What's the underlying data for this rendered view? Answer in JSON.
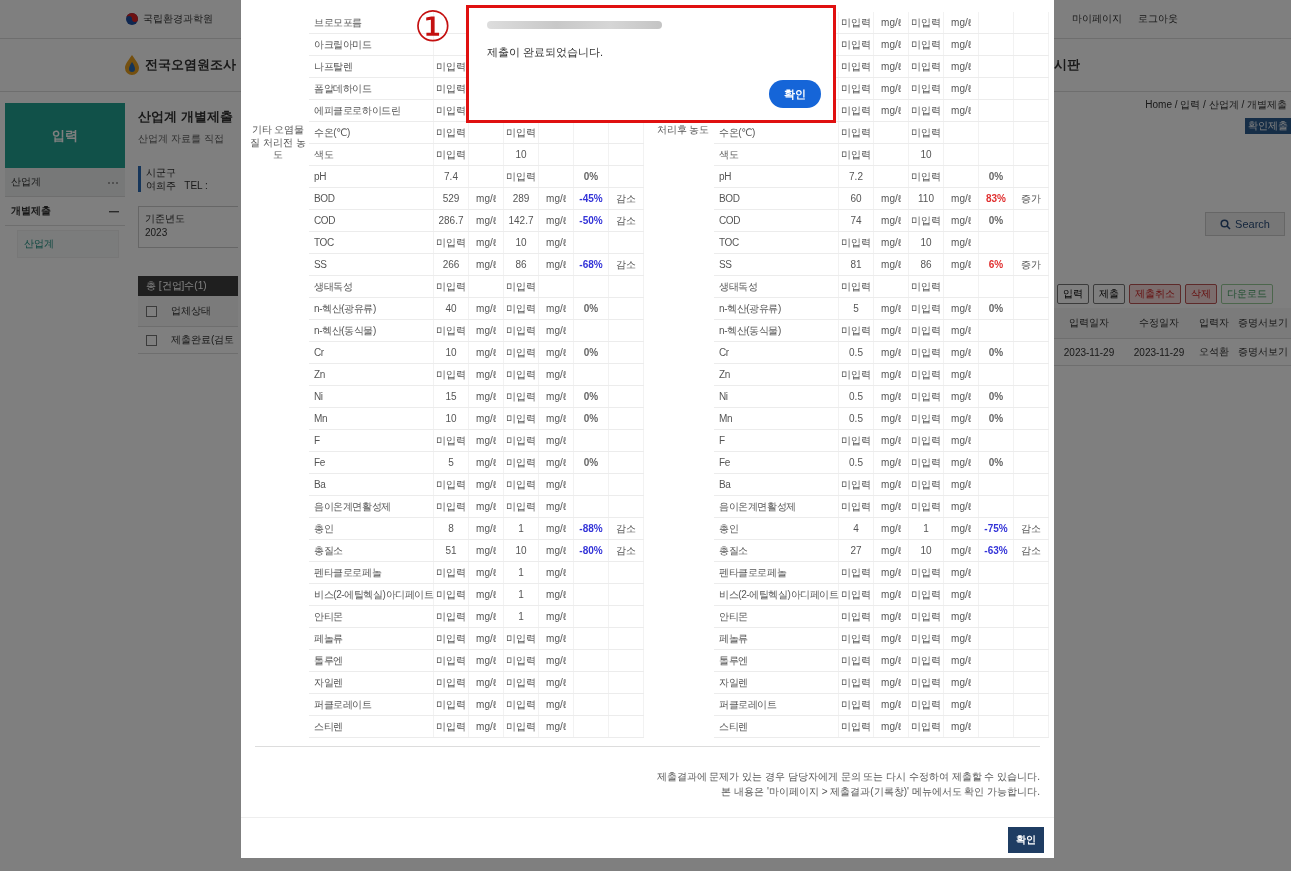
{
  "site": {
    "agency": "국립환경과학원",
    "title": "전국오염원조사",
    "user_links": [
      "마이페이지",
      "로그아웃"
    ],
    "board_fragment": "시판"
  },
  "sidebar": {
    "banner": "입력",
    "items": [
      {
        "label": "산업계",
        "expanded": false
      },
      {
        "label": "개별제출",
        "expanded": true,
        "children": [
          {
            "label": "산업계",
            "selected": true
          }
        ]
      }
    ]
  },
  "page": {
    "title": "산업계 개별제출",
    "subtitle": "산업계 자료를 직접",
    "breadcrumb": "Home / 입력 / 산업계 / 개별제출",
    "badge": "확인제출"
  },
  "info": {
    "label": "시군구",
    "value": "여희주",
    "tel_label": "TEL :"
  },
  "filter": {
    "label": "기준년도",
    "value": "2023",
    "search_button": "Search"
  },
  "list": {
    "summary": "총 [건업]수(1)",
    "header_checked": false,
    "actions": [
      {
        "label": "입력",
        "kind": "default"
      },
      {
        "label": "제출",
        "kind": "default"
      },
      {
        "label": "제출취소",
        "kind": "danger"
      },
      {
        "label": "삭제",
        "kind": "danger"
      },
      {
        "label": "다운로드",
        "kind": "download"
      }
    ],
    "columns_left": [
      "업체상태"
    ],
    "columns_right": [
      "입력일자",
      "수정일자",
      "입력자",
      "증명서보기"
    ],
    "rows": [
      {
        "checked": false,
        "left": [
          "제출완료(검토"
        ],
        "right": [
          "2023-11-29",
          "2023-11-29",
          "오석환",
          "증명서보기"
        ]
      }
    ]
  },
  "modal": {
    "groups": [
      {
        "label": "기타 오염물질 처리전 농도",
        "rows": [
          {
            "name": "브로모포름"
          },
          {
            "name": "아크릴아미드"
          },
          {
            "name": "나프탈렌",
            "column_2": "미입력"
          },
          {
            "name": "폼알데하이드",
            "column_2": "미입력"
          },
          {
            "name": "에피클로로하이드린",
            "column_2": "미입력"
          },
          {
            "name": "수온(℃)",
            "column_2": "미입력",
            "column_4": "미입력"
          },
          {
            "name": "색도",
            "column_2": "미입력",
            "column_4": "10"
          },
          {
            "name": "pH",
            "column_2": "7.4",
            "column_4": "미입력",
            "column_6": "0%",
            "color": "#666666"
          },
          {
            "name": "BOD",
            "column_2": "529",
            "column_3": "mg/ℓ",
            "column_4": "289",
            "column_5": "mg/ℓ",
            "column_6": "-45%",
            "column_7": "감소",
            "color": "#3434d8"
          },
          {
            "name": "COD",
            "column_2": "286.7",
            "column_3": "mg/ℓ",
            "column_4": "142.7",
            "column_5": "mg/ℓ",
            "column_6": "-50%",
            "column_7": "감소",
            "color": "#3434d8"
          },
          {
            "name": "TOC",
            "column_2": "미입력",
            "column_3": "mg/ℓ",
            "column_4": "10",
            "column_5": "mg/ℓ"
          },
          {
            "name": "SS",
            "column_2": "266",
            "column_3": "mg/ℓ",
            "column_4": "86",
            "column_5": "mg/ℓ",
            "column_6": "-68%",
            "column_7": "감소",
            "color": "#3434d8"
          },
          {
            "name": "생태독성",
            "column_2": "미입력",
            "column_4": "미입력"
          },
          {
            "name": "n-헥산(광유류)",
            "column_2": "40",
            "column_3": "mg/ℓ",
            "column_4": "미입력",
            "column_5": "mg/ℓ",
            "column_6": "0%",
            "color": "#666666"
          },
          {
            "name": "n-헥산(동식물)",
            "column_2": "미입력",
            "column_3": "mg/ℓ",
            "column_4": "미입력",
            "column_5": "mg/ℓ"
          },
          {
            "name": "Cr",
            "column_2": "10",
            "column_3": "mg/ℓ",
            "column_4": "미입력",
            "column_5": "mg/ℓ",
            "column_6": "0%",
            "color": "#666666"
          },
          {
            "name": "Zn",
            "column_2": "미입력",
            "column_3": "mg/ℓ",
            "column_4": "미입력",
            "column_5": "mg/ℓ"
          },
          {
            "name": "Ni",
            "column_2": "15",
            "column_3": "mg/ℓ",
            "column_4": "미입력",
            "column_5": "mg/ℓ",
            "column_6": "0%",
            "color": "#666666"
          },
          {
            "name": "Mn",
            "column_2": "10",
            "column_3": "mg/ℓ",
            "column_4": "미입력",
            "column_5": "mg/ℓ",
            "column_6": "0%",
            "color": "#666666"
          },
          {
            "name": "F",
            "column_2": "미입력",
            "column_3": "mg/ℓ",
            "column_4": "미입력",
            "column_5": "mg/ℓ"
          },
          {
            "name": "Fe",
            "column_2": "5",
            "column_3": "mg/ℓ",
            "column_4": "미입력",
            "column_5": "mg/ℓ",
            "column_6": "0%",
            "color": "#666666"
          },
          {
            "name": "Ba",
            "column_2": "미입력",
            "column_3": "mg/ℓ",
            "column_4": "미입력",
            "column_5": "mg/ℓ"
          },
          {
            "name": "음이온계면활성제",
            "column_2": "미입력",
            "column_3": "mg/ℓ",
            "column_4": "미입력",
            "column_5": "mg/ℓ"
          },
          {
            "name": "총인",
            "column_2": "8",
            "column_3": "mg/ℓ",
            "column_4": "1",
            "column_5": "mg/ℓ",
            "column_6": "-88%",
            "column_7": "감소",
            "color": "#3434d8"
          },
          {
            "name": "총질소",
            "column_2": "51",
            "column_3": "mg/ℓ",
            "column_4": "10",
            "column_5": "mg/ℓ",
            "column_6": "-80%",
            "column_7": "감소",
            "color": "#3434d8"
          },
          {
            "name": "펜타클로로페놀",
            "column_2": "미입력",
            "column_3": "mg/ℓ",
            "column_4": "1",
            "column_5": "mg/ℓ"
          },
          {
            "name": "비스(2-에틸헥실)아디페이트",
            "column_2": "미입력",
            "column_3": "mg/ℓ",
            "column_4": "1",
            "column_5": "mg/ℓ"
          },
          {
            "name": "안티몬",
            "column_2": "미입력",
            "column_3": "mg/ℓ",
            "column_4": "1",
            "column_5": "mg/ℓ"
          },
          {
            "name": "페놀류",
            "column_2": "미입력",
            "column_3": "mg/ℓ",
            "column_4": "미입력",
            "column_5": "mg/ℓ"
          },
          {
            "name": "톨루엔",
            "column_2": "미입력",
            "column_3": "mg/ℓ",
            "column_4": "미입력",
            "column_5": "mg/ℓ"
          },
          {
            "name": "자일렌",
            "column_2": "미입력",
            "column_3": "mg/ℓ",
            "column_4": "미입력",
            "column_5": "mg/ℓ"
          },
          {
            "name": "퍼클로레이트",
            "column_2": "미입력",
            "column_3": "mg/ℓ",
            "column_4": "미입력",
            "column_5": "mg/ℓ"
          },
          {
            "name": "스티렌",
            "column_2": "미입력",
            "column_3": "mg/ℓ",
            "column_4": "미입력",
            "column_5": "mg/ℓ"
          }
        ]
      },
      {
        "label": "처리후 농도",
        "rows": [
          {
            "column_2": "미입력",
            "column_3": "mg/ℓ",
            "column_4": "미입력",
            "column_5": "mg/ℓ"
          },
          {
            "column_2": "미입력",
            "column_3": "mg/ℓ",
            "column_4": "미입력",
            "column_5": "mg/ℓ"
          },
          {
            "column_2": "미입력",
            "column_3": "mg/ℓ",
            "column_4": "미입력",
            "column_5": "mg/ℓ"
          },
          {
            "column_2": "미입력",
            "column_3": "mg/ℓ",
            "column_4": "미입력",
            "column_5": "mg/ℓ"
          },
          {
            "column_2": "미입력",
            "column_3": "mg/ℓ",
            "column_4": "미입력",
            "column_5": "mg/ℓ"
          },
          {
            "name": "수온(℃)",
            "column_2": "미입력",
            "column_4": "미입력"
          },
          {
            "name": "색도",
            "column_2": "미입력",
            "column_4": "10"
          },
          {
            "name": "pH",
            "column_2": "7.2",
            "column_4": "미입력",
            "column_6": "0%",
            "color": "#666666"
          },
          {
            "name": "BOD",
            "column_2": "60",
            "column_3": "mg/ℓ",
            "column_4": "110",
            "column_5": "mg/ℓ",
            "column_6": "83%",
            "column_7": "증가",
            "color": "#e03030"
          },
          {
            "name": "COD",
            "column_2": "74",
            "column_3": "mg/ℓ",
            "column_4": "미입력",
            "column_5": "mg/ℓ",
            "column_6": "0%",
            "color": "#666666"
          },
          {
            "name": "TOC",
            "column_2": "미입력",
            "column_3": "mg/ℓ",
            "column_4": "10",
            "column_5": "mg/ℓ"
          },
          {
            "name": "SS",
            "column_2": "81",
            "column_3": "mg/ℓ",
            "column_4": "86",
            "column_5": "mg/ℓ",
            "column_6": "6%",
            "column_7": "증가",
            "color": "#e03030"
          },
          {
            "name": "생태독성",
            "column_2": "미입력",
            "column_4": "미입력"
          },
          {
            "name": "n-헥산(광유류)",
            "column_2": "5",
            "column_3": "mg/ℓ",
            "column_4": "미입력",
            "column_5": "mg/ℓ",
            "column_6": "0%",
            "color": "#666666"
          },
          {
            "name": "n-헥산(동식물)",
            "column_2": "미입력",
            "column_3": "mg/ℓ",
            "column_4": "미입력",
            "column_5": "mg/ℓ"
          },
          {
            "name": "Cr",
            "column_2": "0.5",
            "column_3": "mg/ℓ",
            "column_4": "미입력",
            "column_5": "mg/ℓ",
            "column_6": "0%",
            "color": "#666666"
          },
          {
            "name": "Zn",
            "column_2": "미입력",
            "column_3": "mg/ℓ",
            "column_4": "미입력",
            "column_5": "mg/ℓ"
          },
          {
            "name": "Ni",
            "column_2": "0.5",
            "column_3": "mg/ℓ",
            "column_4": "미입력",
            "column_5": "mg/ℓ",
            "column_6": "0%",
            "color": "#666666"
          },
          {
            "name": "Mn",
            "column_2": "0.5",
            "column_3": "mg/ℓ",
            "column_4": "미입력",
            "column_5": "mg/ℓ",
            "column_6": "0%",
            "color": "#666666"
          },
          {
            "name": "F",
            "column_2": "미입력",
            "column_3": "mg/ℓ",
            "column_4": "미입력",
            "column_5": "mg/ℓ"
          },
          {
            "name": "Fe",
            "column_2": "0.5",
            "column_3": "mg/ℓ",
            "column_4": "미입력",
            "column_5": "mg/ℓ",
            "column_6": "0%",
            "color": "#666666"
          },
          {
            "name": "Ba",
            "column_2": "미입력",
            "column_3": "mg/ℓ",
            "column_4": "미입력",
            "column_5": "mg/ℓ"
          },
          {
            "name": "음이온계면활성제",
            "column_2": "미입력",
            "column_3": "mg/ℓ",
            "column_4": "미입력",
            "column_5": "mg/ℓ"
          },
          {
            "name": "총인",
            "column_2": "4",
            "column_3": "mg/ℓ",
            "column_4": "1",
            "column_5": "mg/ℓ",
            "column_6": "-75%",
            "column_7": "감소",
            "color": "#3434d8"
          },
          {
            "name": "총질소",
            "column_2": "27",
            "column_3": "mg/ℓ",
            "column_4": "10",
            "column_5": "mg/ℓ",
            "column_6": "-63%",
            "column_7": "감소",
            "color": "#3434d8"
          },
          {
            "name": "펜타클로로페놀",
            "column_2": "미입력",
            "column_3": "mg/ℓ",
            "column_4": "미입력",
            "column_5": "mg/ℓ"
          },
          {
            "name": "비스(2-에틸헥실)아디페이트",
            "column_2": "미입력",
            "column_3": "mg/ℓ",
            "column_4": "미입력",
            "column_5": "mg/ℓ"
          },
          {
            "name": "안티몬",
            "column_2": "미입력",
            "column_3": "mg/ℓ",
            "column_4": "미입력",
            "column_5": "mg/ℓ"
          },
          {
            "name": "페놀류",
            "column_2": "미입력",
            "column_3": "mg/ℓ",
            "column_4": "미입력",
            "column_5": "mg/ℓ"
          },
          {
            "name": "톨루엔",
            "column_2": "미입력",
            "column_3": "mg/ℓ",
            "column_4": "미입력",
            "column_5": "mg/ℓ"
          },
          {
            "name": "자일렌",
            "column_2": "미입력",
            "column_3": "mg/ℓ",
            "column_4": "미입력",
            "column_5": "mg/ℓ"
          },
          {
            "name": "퍼클로레이트",
            "column_2": "미입력",
            "column_3": "mg/ℓ",
            "column_4": "미입력",
            "column_5": "mg/ℓ"
          },
          {
            "name": "스티렌",
            "column_2": "미입력",
            "column_3": "mg/ℓ",
            "column_4": "미입력",
            "column_5": "mg/ℓ"
          }
        ]
      }
    ],
    "notes": [
      "제출결과에 문제가 있는 경우 담당자에게 문의 또는 다시 수정하여 제출할 수 있습니다.",
      "본 내용은 '마이페이지 > 제출결과(기록창)' 메뉴에서도 확인 가능합니다."
    ],
    "confirm_button": "확인"
  },
  "alert": {
    "marker": "①",
    "message": "제출이 완료되었습니다.",
    "button": "확인"
  }
}
